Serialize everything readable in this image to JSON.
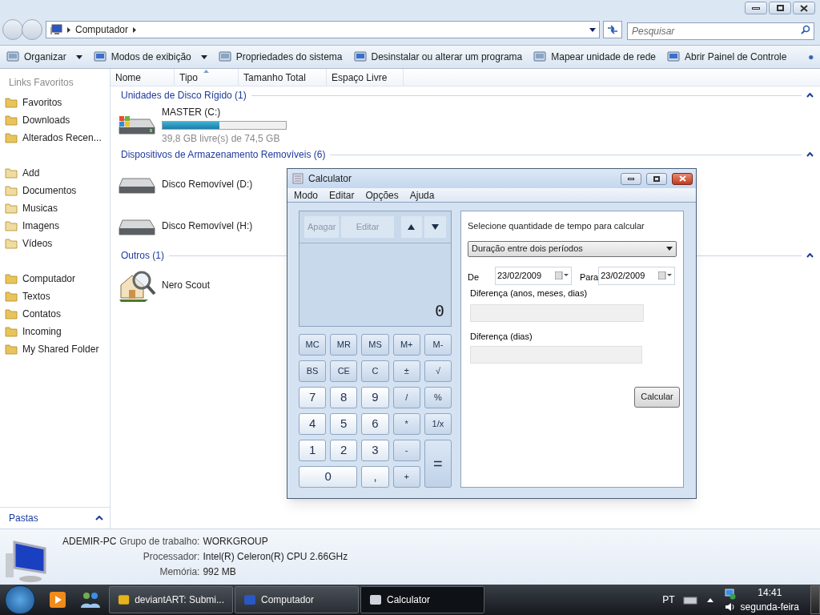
{
  "explorer": {
    "address": {
      "crumbs": [
        "Computador"
      ]
    },
    "search": {
      "placeholder": "Pesquisar"
    },
    "toolbar": [
      {
        "label": "Organizar",
        "dropdown": true
      },
      {
        "label": "Modos de exibição",
        "dropdown": true
      },
      {
        "label": "Propriedades do sistema",
        "dropdown": false
      },
      {
        "label": "Desinstalar ou alterar um programa",
        "dropdown": false
      },
      {
        "label": "Mapear unidade de rede",
        "dropdown": false
      },
      {
        "label": "Abrir Painel de Controle",
        "dropdown": false
      }
    ],
    "columns": [
      {
        "label": "Nome",
        "sorted": false
      },
      {
        "label": "Tipo",
        "sorted": true
      },
      {
        "label": "Tamanho Total",
        "sorted": false
      },
      {
        "label": "Espaço Livre",
        "sorted": false
      }
    ],
    "sidebar": {
      "title": "Links Favoritos",
      "groups": [
        [
          "Favoritos",
          "Downloads",
          "Alterados Recen..."
        ],
        [
          "Add",
          "Documentos",
          "Musicas",
          "Imagens",
          "Vídeos"
        ],
        [
          "Computador",
          "Textos",
          "Contatos",
          "Incoming",
          "My Shared Folder"
        ]
      ],
      "folders": "Pastas"
    },
    "groups": [
      {
        "title": "Unidades de Disco Rígido (1)",
        "items": [
          {
            "name": "MASTER (C:)",
            "kind": "hdd",
            "level": 0.46,
            "free": "39,8 GB livre(s) de 74,5 GB"
          }
        ]
      },
      {
        "title": "Dispositivos de Armazenamento Removíveis (6)",
        "items": [
          {
            "name": "Disco Removível (D:)",
            "kind": "removable"
          },
          {
            "name": "Disco Removível (H:)",
            "kind": "removable"
          }
        ]
      },
      {
        "title": "Outros (1)",
        "items": [
          {
            "name": "Nero Scout",
            "kind": "program"
          }
        ]
      }
    ],
    "details": {
      "name": "ADEMIR-PC",
      "rows": [
        {
          "label": "Grupo de trabalho:",
          "value": "WORKGROUP"
        },
        {
          "label": "Processador:",
          "value": "Intel(R) Celeron(R) CPU 2.66GHz"
        },
        {
          "label": "Memória:",
          "value": "992 MB"
        }
      ]
    }
  },
  "calculator": {
    "title": "Calculator",
    "menu": [
      "Modo",
      "Editar",
      "Opções",
      "Ajuda"
    ],
    "history": {
      "clear": "Apagar",
      "edit": "Editar"
    },
    "display": "0",
    "keys": [
      {
        "label": "MC",
        "kind": "fn"
      },
      {
        "label": "MR",
        "kind": "fn"
      },
      {
        "label": "MS",
        "kind": "fn"
      },
      {
        "label": "M+",
        "kind": "fn"
      },
      {
        "label": "M-",
        "kind": "fn"
      },
      {
        "label": "BS",
        "kind": "fn"
      },
      {
        "label": "CE",
        "kind": "fn"
      },
      {
        "label": "C",
        "kind": "fn"
      },
      {
        "label": "±",
        "kind": "fn"
      },
      {
        "label": "√",
        "kind": "fn"
      },
      {
        "label": "7",
        "kind": "digit"
      },
      {
        "label": "8",
        "kind": "digit"
      },
      {
        "label": "9",
        "kind": "digit"
      },
      {
        "label": "/",
        "kind": "fn"
      },
      {
        "label": "%",
        "kind": "fn"
      },
      {
        "label": "4",
        "kind": "digit"
      },
      {
        "label": "5",
        "kind": "digit"
      },
      {
        "label": "6",
        "kind": "digit"
      },
      {
        "label": "*",
        "kind": "fn"
      },
      {
        "label": "1/x",
        "kind": "fn"
      },
      {
        "label": "1",
        "kind": "digit"
      },
      {
        "label": "2",
        "kind": "digit"
      },
      {
        "label": "3",
        "kind": "digit"
      },
      {
        "label": "-",
        "kind": "fn"
      },
      {
        "label": "=",
        "kind": "tall"
      },
      {
        "label": "0",
        "kind": "wide"
      },
      {
        "label": ",",
        "kind": "digit"
      },
      {
        "label": "+",
        "kind": "fn"
      }
    ],
    "panel": {
      "heading": "Selecione quantidade de tempo para calcular",
      "mode": "Duração entre dois períodos",
      "from_label": "De",
      "from": "23/02/2009",
      "to_label": "Para",
      "to": "23/02/2009",
      "diff_ymd_label": "Diferença (anos, meses, dias)",
      "diff_days_label": "Diferença (dias)",
      "button": "Calcular"
    }
  },
  "taskbar": {
    "tasks": [
      {
        "label": "deviantART: Submi...",
        "selected": false
      },
      {
        "label": "Computador",
        "selected": false
      },
      {
        "label": "Calculator",
        "selected": true
      }
    ],
    "language": "PT",
    "time": "14:41",
    "day": "segunda-feira"
  }
}
